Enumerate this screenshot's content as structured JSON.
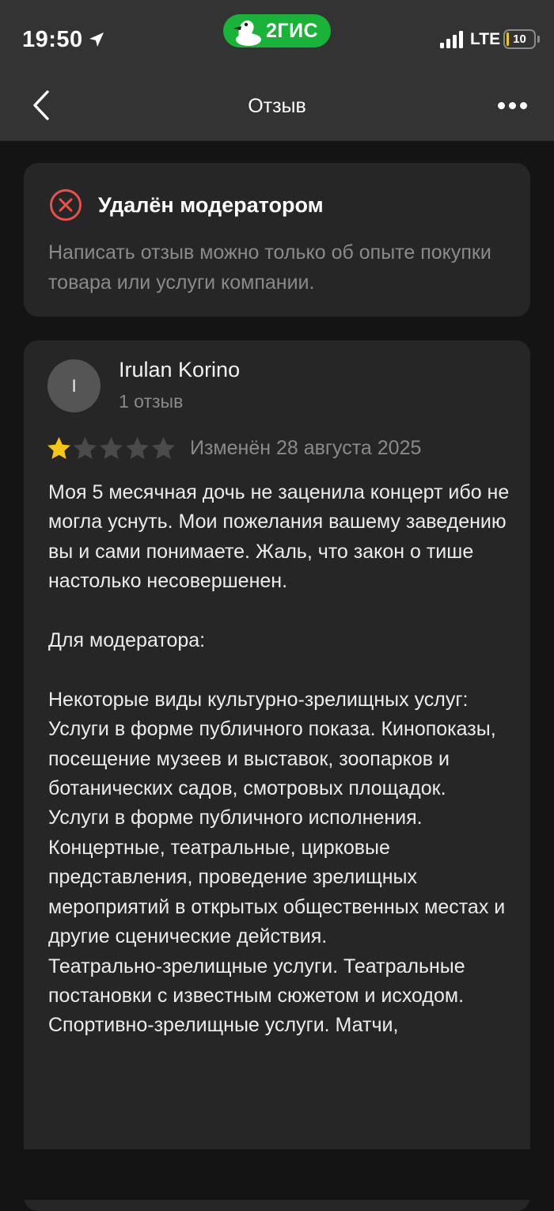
{
  "status_bar": {
    "time": "19:50",
    "brand_label": "2ГИС",
    "network": "LTE",
    "battery_level": "10",
    "battery_fraction": 0.1
  },
  "nav": {
    "title": "Отзыв"
  },
  "notice": {
    "title": "Удалён модератором",
    "text": "Написать отзыв можно только об опыте покупки товара или услуги компании.",
    "icon": "x-circle-icon",
    "icon_color": "#e8504a"
  },
  "review": {
    "avatar_letter": "I",
    "author": "Irulan Korino",
    "review_count": "1 отзыв",
    "rating": 1,
    "rating_max": 5,
    "edited": "Изменён 28 августа 2025",
    "body": "Моя 5 месячная дочь не заценила концерт ибо не могла уснуть. Мои пожелания вашему заведению вы и сами понимаете. Жаль, что закон о тише настолько несовершенен.\n\nДля модератора:\n\nНекоторые виды культурно-зрелищных услуг:\nУслуги в форме публичного показа. Кинопоказы, посещение музеев и выставок, зоопарков и ботанических садов, смотровых площадок.\nУслуги в форме публичного исполнения. Концертные, театральные, цирковые представления, проведение зрелищных мероприятий в открытых общественных местах и другие сценические действия.\nТеатрально-зрелищные услуги. Театральные постановки с известным сюжетом и исходом.\nСпортивно-зрелищные услуги. Матчи,"
  },
  "colors": {
    "header_bg": "#333333",
    "page_bg": "#141414",
    "card_bg": "#262626",
    "brand_green": "#19b33a",
    "star_filled": "#f5c518",
    "star_empty": "#4a4a4a"
  }
}
